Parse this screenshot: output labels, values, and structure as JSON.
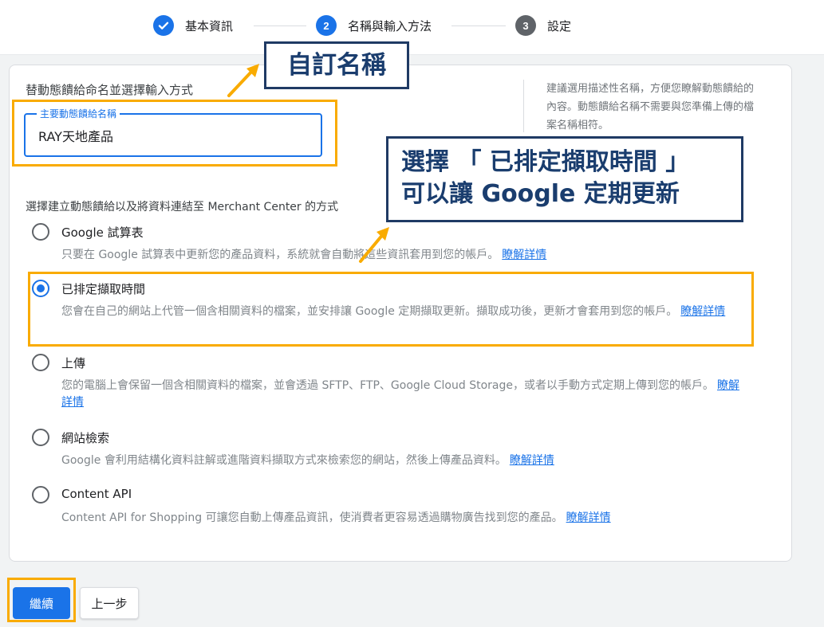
{
  "colors": {
    "primary": "#1a73e8",
    "highlight": "#f9ab00",
    "callout_border": "#1f3a64",
    "callout_text": "#1a3d6e"
  },
  "stepper": {
    "steps": [
      {
        "label": "基本資訊",
        "state": "done",
        "icon": "check-icon"
      },
      {
        "label": "名稱與輸入方法",
        "state": "active",
        "number": "2"
      },
      {
        "label": "設定",
        "state": "pending",
        "number": "3"
      }
    ]
  },
  "form": {
    "section_title": "替動態饋給命名並選擇輸入方式",
    "name_label": "主要動態饋給名稱",
    "name_value": "RAY天地產品",
    "help_text": "建議選用描述性名稱，方便您瞭解動態饋給的內容。動態饋給名稱不需要與您準備上傳的檔案名稱相符。",
    "method_title": "選擇建立動態饋給以及將資料連結至 Merchant Center 的方式",
    "options": [
      {
        "title": "Google 試算表",
        "desc": "只要在 Google 試算表中更新您的產品資料，系統就會自動將這些資訊套用到您的帳戶。",
        "link": "瞭解詳情",
        "selected": false
      },
      {
        "title": "已排定擷取時間",
        "desc": "您會在自己的網站上代管一個含相關資料的檔案，並安排讓 Google 定期擷取更新。擷取成功後，更新才會套用到您的帳戶。",
        "link": "瞭解詳情",
        "selected": true
      },
      {
        "title": "上傳",
        "desc": "您的電腦上會保留一個含相關資料的檔案，並會透過 SFTP、FTP、Google Cloud Storage，或者以手動方式定期上傳到您的帳戶。",
        "link": "瞭解詳情",
        "selected": false
      },
      {
        "title": "網站檢索",
        "desc": "Google 會利用結構化資料註解或進階資料擷取方式來檢索您的網站，然後上傳產品資料。",
        "link": "瞭解詳情",
        "selected": false
      },
      {
        "title": "Content API",
        "desc": "Content API for Shopping 可讓您自動上傳產品資訊，使消費者更容易透過購物廣告找到您的產品。",
        "link": "瞭解詳情",
        "selected": false
      }
    ]
  },
  "buttons": {
    "continue": "繼續",
    "back": "上一步"
  },
  "annotations": {
    "callout_name": "自訂名稱",
    "callout_schedule_line1": "選擇 「 已排定擷取時間 」",
    "callout_schedule_line2": "可以讓 Google 定期更新"
  }
}
